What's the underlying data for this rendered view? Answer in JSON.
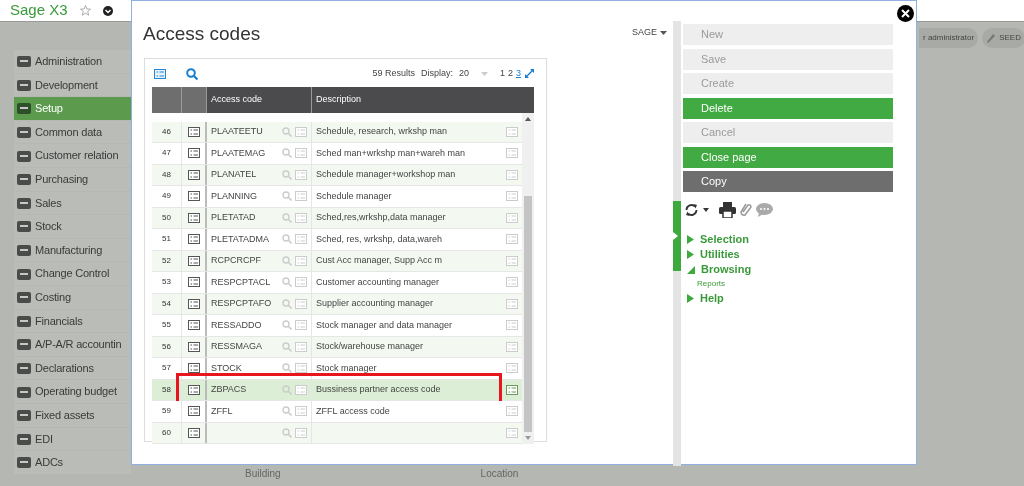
{
  "app": {
    "title": "Sage X3"
  },
  "header_chips": [
    "r administrator",
    "SEED"
  ],
  "sidebar": {
    "items": [
      {
        "label": "Administration",
        "selected": false
      },
      {
        "label": "Development",
        "selected": false
      },
      {
        "label": "Setup",
        "selected": true
      },
      {
        "label": "Common data",
        "selected": false
      },
      {
        "label": "Customer relation",
        "selected": false
      },
      {
        "label": "Purchasing",
        "selected": false
      },
      {
        "label": "Sales",
        "selected": false
      },
      {
        "label": "Stock",
        "selected": false
      },
      {
        "label": "Manufacturing",
        "selected": false
      },
      {
        "label": "Change Control",
        "selected": false
      },
      {
        "label": "Costing",
        "selected": false
      },
      {
        "label": "Financials",
        "selected": false
      },
      {
        "label": "A/P-A/R accountin",
        "selected": false
      },
      {
        "label": "Declarations",
        "selected": false
      },
      {
        "label": "Operating budget",
        "selected": false
      },
      {
        "label": "Fixed assets",
        "selected": false
      },
      {
        "label": "EDI",
        "selected": false
      },
      {
        "label": "ADCs",
        "selected": false
      }
    ]
  },
  "background_labels": [
    "Building",
    "Location"
  ],
  "dialog": {
    "title": "Access codes",
    "folder": "SAGE",
    "results": "59 Results",
    "display_label": "Display:",
    "display_value": "20",
    "pages": [
      {
        "label": "1",
        "selected": false
      },
      {
        "label": "2",
        "selected": false
      },
      {
        "label": "3",
        "selected": true
      }
    ],
    "columns": [
      "Access code",
      "Description"
    ],
    "rows": [
      {
        "number": "46",
        "code": "PLAATEETU",
        "description": "Schedule, research, wrkshp man",
        "selected": false,
        "highlighted": false
      },
      {
        "number": "47",
        "code": "PLAATEMAG",
        "description": "Sched man+wrkshp man+wareh man",
        "selected": false,
        "highlighted": false
      },
      {
        "number": "48",
        "code": "PLANATEL",
        "description": "Schedule manager+workshop man",
        "selected": false,
        "highlighted": false
      },
      {
        "number": "49",
        "code": "PLANNING",
        "description": "Schedule manager",
        "selected": false,
        "highlighted": false
      },
      {
        "number": "50",
        "code": "PLETATAD",
        "description": "Sched,res,wrkshp,data manager",
        "selected": false,
        "highlighted": false
      },
      {
        "number": "51",
        "code": "PLETATADMA",
        "description": "Sched, res, wrkshp, data,wareh",
        "selected": false,
        "highlighted": false
      },
      {
        "number": "52",
        "code": "RCPCRCPF",
        "description": "Cust Acc manager, Supp Acc m",
        "selected": false,
        "highlighted": false
      },
      {
        "number": "53",
        "code": "RESPCPTACL",
        "description": "Customer accounting manager",
        "selected": false,
        "highlighted": false
      },
      {
        "number": "54",
        "code": "RESPCPTAFO",
        "description": "Supplier accounting manager",
        "selected": false,
        "highlighted": false
      },
      {
        "number": "55",
        "code": "RESSADDO",
        "description": "Stock manager and data manager",
        "selected": false,
        "highlighted": false
      },
      {
        "number": "56",
        "code": "RESSMAGA",
        "description": "Stock/warehouse manager",
        "selected": false,
        "highlighted": false
      },
      {
        "number": "57",
        "code": "STOCK",
        "description": "Stock manager",
        "selected": false,
        "highlighted": false
      },
      {
        "number": "58",
        "code": "ZBPACS",
        "description": "Bussiness partner access code",
        "selected": true,
        "highlighted": true
      },
      {
        "number": "59",
        "code": "ZFFL",
        "description": "ZFFL access code",
        "selected": false,
        "highlighted": false
      },
      {
        "number": "60",
        "selected": false,
        "highlighted": false
      }
    ]
  },
  "actions": [
    {
      "label": "New",
      "kind": "disabled"
    },
    {
      "label": "Save",
      "kind": "disabled"
    },
    {
      "label": "Create",
      "kind": "disabled"
    },
    {
      "label": "Delete",
      "kind": "primary"
    },
    {
      "label": "Cancel",
      "kind": "disabled"
    },
    {
      "label": "Close page",
      "kind": "primary"
    },
    {
      "label": "Copy",
      "kind": "secondary"
    }
  ],
  "menu": [
    {
      "label": "Selection",
      "expanded": false
    },
    {
      "label": "Utilities",
      "expanded": false
    },
    {
      "label": "Browsing",
      "expanded": true,
      "children": [
        {
          "label": "Reports"
        }
      ]
    },
    {
      "label": "Help",
      "expanded": false
    }
  ]
}
